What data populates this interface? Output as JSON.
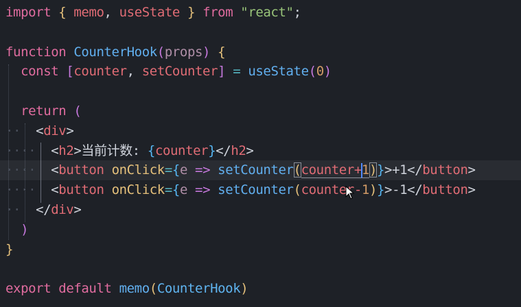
{
  "editor": {
    "lines": [
      {
        "id": "l1",
        "tokens": [
          "import",
          "{",
          "memo",
          ",",
          "useState",
          "}",
          "from",
          "\"react\"",
          ";"
        ]
      },
      {
        "id": "l3",
        "tokens": [
          "function",
          "CounterHook",
          "(",
          "props",
          ")",
          "{"
        ]
      },
      {
        "id": "l4",
        "tokens": [
          "const",
          "[",
          "counter",
          ",",
          "setCounter",
          "]",
          "=",
          "useState",
          "(",
          "0",
          ")"
        ]
      },
      {
        "id": "l6",
        "tokens": [
          "return",
          "("
        ]
      },
      {
        "id": "l7",
        "tokens": [
          "<",
          "div",
          ">"
        ]
      },
      {
        "id": "l8",
        "tokens": [
          "<",
          "h2",
          ">",
          "当前计数: ",
          "{",
          "counter",
          "}",
          "</",
          "h2",
          ">"
        ]
      },
      {
        "id": "l9",
        "tokens": [
          "<",
          "button",
          "onClick",
          "=",
          "{",
          "e",
          "=>",
          "setCounter",
          "(",
          "counter+",
          "1",
          ")",
          "}",
          ">+1</",
          "button",
          ">"
        ]
      },
      {
        "id": "l10",
        "tokens": [
          "<",
          "button",
          "onClick",
          "=",
          "{",
          "e",
          "=>",
          "setCounter",
          "(",
          "counter-",
          "1",
          ")",
          "}",
          ">-1</",
          "button",
          ">"
        ]
      },
      {
        "id": "l11",
        "tokens": [
          "</",
          "div",
          ">"
        ]
      },
      {
        "id": "l12",
        "tokens": [
          ")"
        ]
      },
      {
        "id": "l13",
        "tokens": [
          "}"
        ]
      },
      {
        "id": "l15",
        "tokens": [
          "export",
          "default",
          "memo",
          "(",
          "CounterHook",
          ")"
        ]
      }
    ]
  },
  "colors": {
    "background": "#1e2127",
    "keyword": "#e06c9f",
    "function": "#61afef",
    "string": "#98c379",
    "number": "#d19a66",
    "tag": "#e06c75",
    "cursor": "#528bff"
  }
}
